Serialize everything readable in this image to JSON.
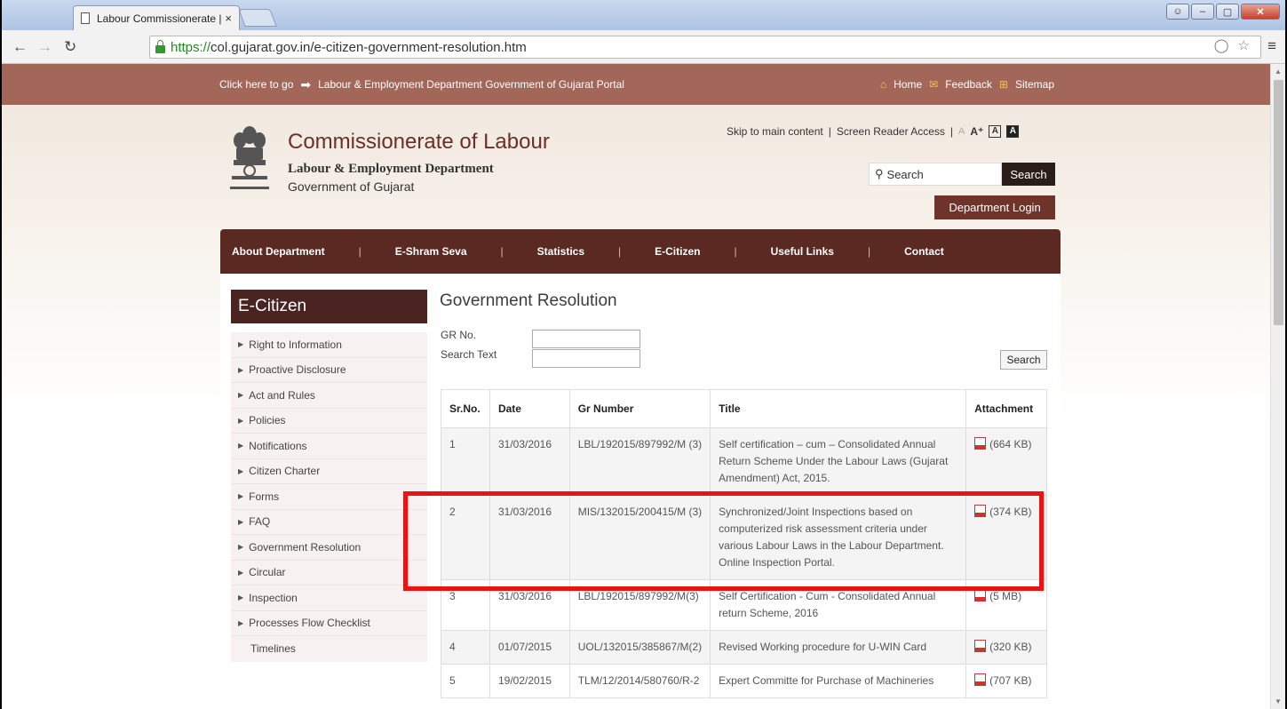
{
  "browser": {
    "tab_title": "Labour Commissionerate |",
    "tab_close": "×",
    "url_scheme": "https://",
    "url_rest": "col.gujarat.gov.in/e-citizen-government-resolution.htm"
  },
  "topstrip": {
    "goto_text": "Click here to go",
    "portal_link": "Labour & Employment Department Government of Gujarat Portal",
    "home": "Home",
    "feedback": "Feedback",
    "sitemap": "Sitemap"
  },
  "header": {
    "title": "Commissionerate of Labour",
    "subtitle": "Labour & Employment Department",
    "government": "Government of Gujarat",
    "skip_link": "Skip to main content",
    "screen_reader": "Screen Reader Access",
    "font_small": "A",
    "font_large": "A⁺",
    "contrast_normal": "A",
    "contrast_high": "A",
    "search_placeholder": "Search",
    "search_button": "Search",
    "dept_login": "Department Login"
  },
  "nav": {
    "items": [
      "About Department",
      "E-Shram Seva",
      "Statistics",
      "E-Citizen",
      "Useful Links",
      "Contact"
    ]
  },
  "sidebar": {
    "heading": "E-Citizen",
    "items": [
      "Right to Information",
      "Proactive Disclosure",
      "Act and Rules",
      "Policies",
      "Notifications",
      "Citizen Charter",
      "Forms",
      "FAQ",
      "Government Resolution",
      "Circular",
      "Inspection",
      "Processes Flow Checklist"
    ],
    "extra": "Timelines"
  },
  "main": {
    "title": "Government Resolution",
    "gr_no_label": "GR No.",
    "search_text_label": "Search Text",
    "search_button": "Search",
    "table": {
      "headers": [
        "Sr.No.",
        "Date",
        "Gr Number",
        "Title",
        "Attachment"
      ],
      "rows": [
        [
          "1",
          "31/03/2016",
          "LBL/192015/897992/M (3)",
          "Self certification – cum – Consolidated Annual Return Scheme Under the Labour Laws (Gujarat Amendment) Act, 2015.",
          "(664 KB)"
        ],
        [
          "2",
          "31/03/2016",
          "MIS/132015/200415/M (3)",
          "Synchronized/Joint Inspections based on computerized risk assessment criteria under various Labour Laws in the Labour Department. Online Inspection Portal.",
          "(374 KB)"
        ],
        [
          "3",
          "31/03/2016",
          "LBL/192015/897992/M(3)",
          "Self Certification - Cum - Consolidated Annual return Scheme, 2016",
          "(5 MB)"
        ],
        [
          "4",
          "01/07/2015",
          "UOL/132015/385867/M(2)",
          "Revised Working procedure for U-WIN Card",
          "(320 KB)"
        ],
        [
          "5",
          "19/02/2015",
          "TLM/12/2014/580760/R-2",
          "Expert Committe for Purchase of Machineries",
          "(707 KB)"
        ]
      ]
    }
  }
}
